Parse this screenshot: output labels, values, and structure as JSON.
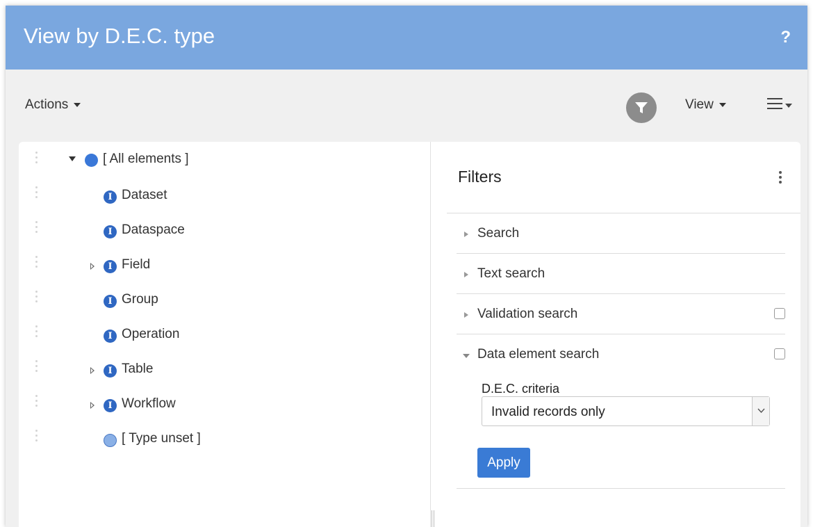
{
  "header": {
    "title": "View by D.E.C. type",
    "help_label": "?"
  },
  "toolbar": {
    "actions_label": "Actions",
    "view_label": "View"
  },
  "tree": {
    "items": [
      {
        "label": "[ All elements ]",
        "icon": "blue-dot-icon",
        "expandable": true,
        "expanded": true
      },
      {
        "label": "Dataset",
        "icon": "info-icon",
        "expandable": false
      },
      {
        "label": "Dataspace",
        "icon": "info-icon",
        "expandable": false
      },
      {
        "label": "Field",
        "icon": "info-icon",
        "expandable": true,
        "expanded": false
      },
      {
        "label": "Group",
        "icon": "info-icon",
        "expandable": false
      },
      {
        "label": "Operation",
        "icon": "info-icon",
        "expandable": false
      },
      {
        "label": "Table",
        "icon": "info-icon",
        "expandable": true,
        "expanded": false
      },
      {
        "label": "Workflow",
        "icon": "info-icon",
        "expandable": true,
        "expanded": false
      },
      {
        "label": "[ Type unset ]",
        "icon": "light-blue-dot-icon",
        "expandable": false
      }
    ]
  },
  "filters": {
    "title": "Filters",
    "sections": [
      {
        "label": "Search",
        "expanded": false,
        "checkbox": false
      },
      {
        "label": "Text search",
        "expanded": false,
        "checkbox": false
      },
      {
        "label": "Validation search",
        "expanded": false,
        "checkbox": true,
        "checked": false
      },
      {
        "label": "Data element search",
        "expanded": true,
        "checkbox": true,
        "checked": false
      }
    ],
    "dec_criteria_label": "D.E.C. criteria",
    "dec_criteria_value": "Invalid records only",
    "apply_label": "Apply"
  }
}
